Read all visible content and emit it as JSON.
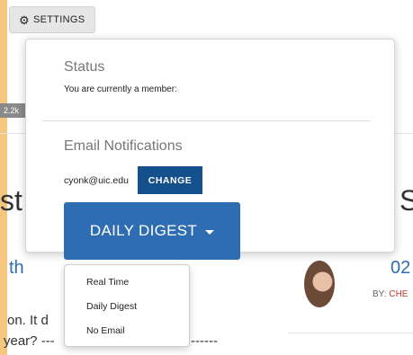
{
  "toolbar": {
    "settings_label": "SETTINGS"
  },
  "background": {
    "badge_text": "2.2k",
    "heading_left": "st",
    "heading_right": "S",
    "link_left": "th",
    "link_right": "02",
    "by_label": "BY:",
    "author": "CHE",
    "line1": "on.  It d",
    "line2": "year? ---",
    "line2_right": "------"
  },
  "panel": {
    "status_heading": "Status",
    "status_text": "You are currently a member:",
    "email_heading": "Email Notifications",
    "email_address": "cyonk@uic.edu",
    "change_label": "CHANGE",
    "digest_label": "DAILY DIGEST"
  },
  "dropdown": {
    "options": [
      "Real Time",
      "Daily Digest",
      "No Email"
    ]
  },
  "colors": {
    "accent": "#2e6db2",
    "change_button": "#13508c",
    "link_color": "#2e6db2",
    "author_color": "#c0392b",
    "left_strip": "#f5c77e"
  }
}
